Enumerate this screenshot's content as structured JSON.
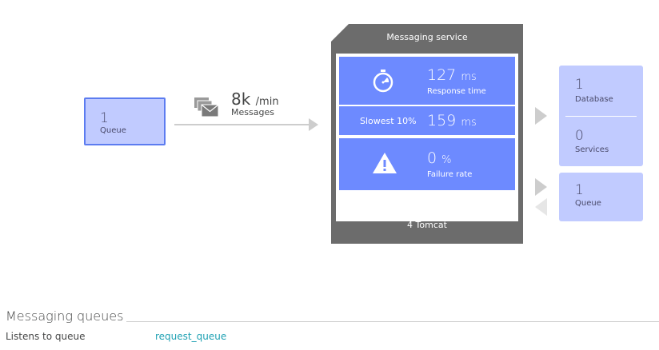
{
  "source_queue": {
    "count": "1",
    "label": "Queue"
  },
  "messages": {
    "value": "8k",
    "unit": "/min",
    "label": "Messages",
    "icon": "messages-icon"
  },
  "service": {
    "title": "Messaging service",
    "response_time": {
      "value": "127",
      "unit": "ms",
      "label": "Response time",
      "icon": "stopwatch-icon"
    },
    "slowest": {
      "label": "Slowest 10%",
      "value": "159",
      "unit": "ms"
    },
    "failure_rate": {
      "value": "0",
      "unit": "%",
      "label": "Failure rate",
      "icon": "warning-icon"
    },
    "footer": "4 Tomcat"
  },
  "callees": {
    "database": {
      "count": "1",
      "label": "Database"
    },
    "services": {
      "count": "0",
      "label": "Services"
    }
  },
  "queue_right": {
    "count": "1",
    "label": "Queue"
  },
  "messaging_queues": {
    "title": "Messaging queues",
    "rows": [
      {
        "key": "Listens to queue",
        "value": "request_queue"
      }
    ]
  },
  "colors": {
    "metric_blue": "#6d8aff",
    "box_blue": "#c1cbff",
    "selected_border": "#5c7cf0",
    "service_gray": "#6c6c6c",
    "link_teal": "#1fa1b3"
  }
}
